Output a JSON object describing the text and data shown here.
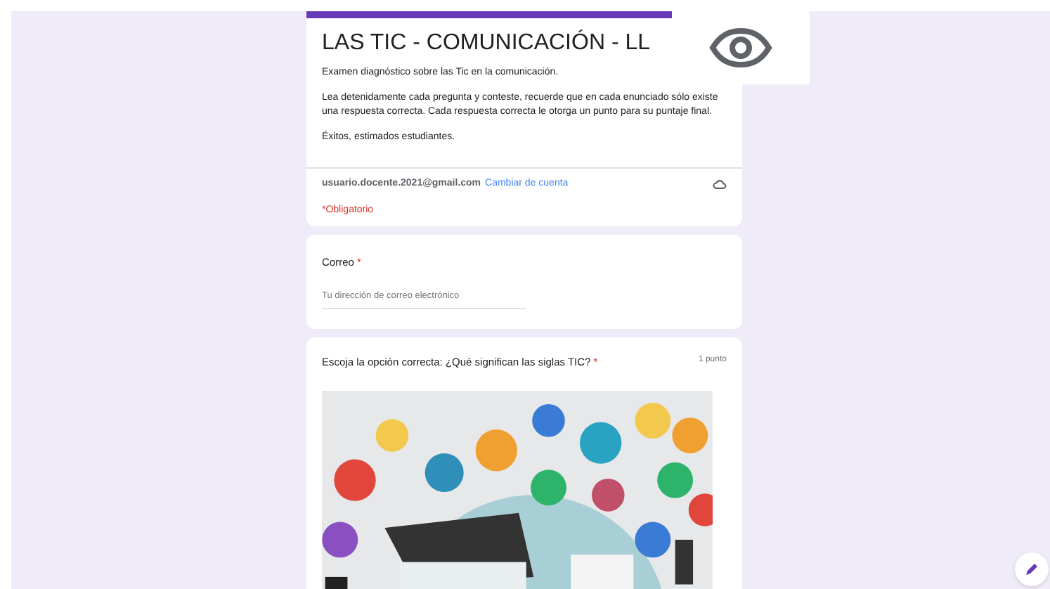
{
  "form": {
    "title": "LAS TIC - COMUNICACIÓN - LL",
    "description": [
      "Examen diagnóstico sobre las Tic en la comunicación.",
      "Lea detenidamente cada pregunta y conteste, recuerde que en cada enunciado sólo existe una respuesta correcta. Cada respuesta correcta le otorga un punto para su puntaje final.",
      "Éxitos, estimados estudiantes."
    ],
    "account": "usuario.docente.2021@gmail.com",
    "switch_account": "Cambiar de cuenta",
    "required_note": "*Obligatorio"
  },
  "questions": [
    {
      "kind": "text",
      "label": "Correo",
      "required_mark": "*",
      "placeholder": "Tu dirección de correo electrónico"
    },
    {
      "label": "Escoja la opción correcta: ¿Qué significan las siglas TIC?",
      "required_mark": "*",
      "points": "1 punto"
    }
  ]
}
